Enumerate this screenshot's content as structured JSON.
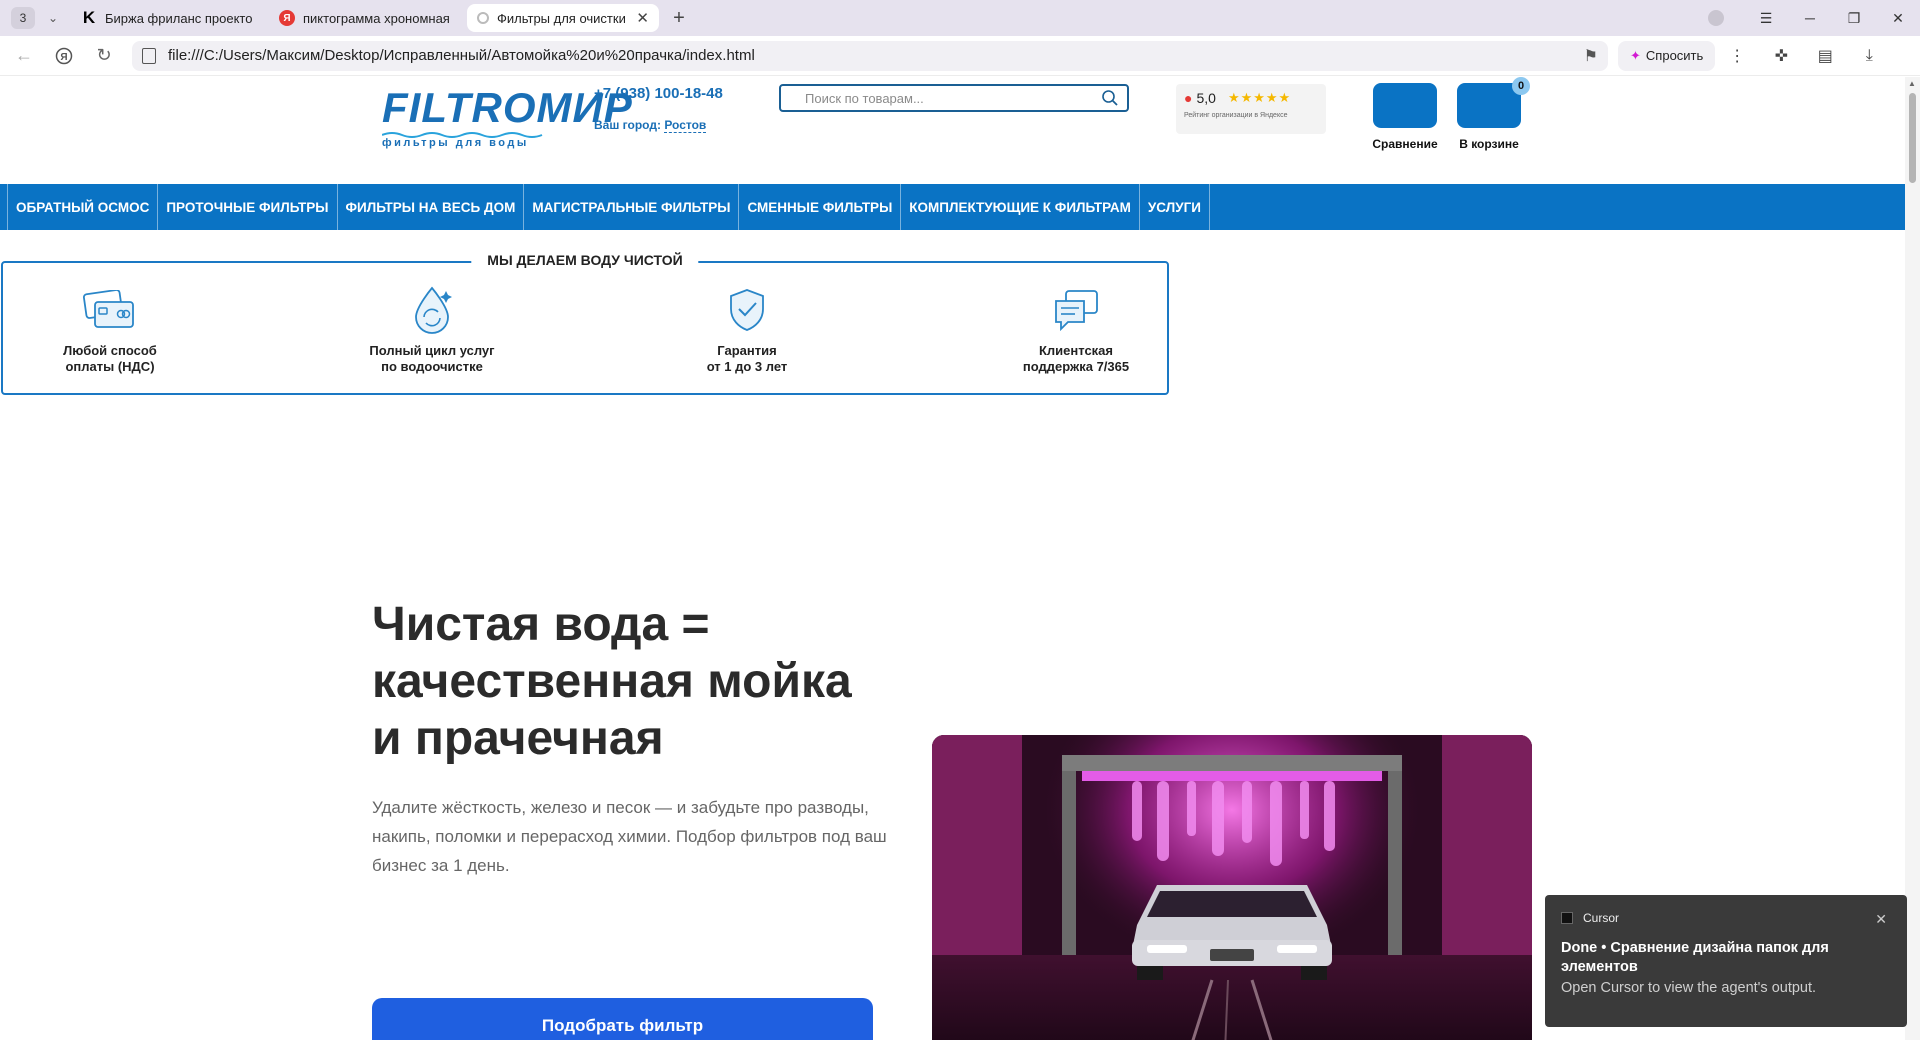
{
  "browser": {
    "tab_count": "3",
    "tabs": [
      {
        "title": "Биржа фриланс проектов",
        "favicon": "kwork-icon"
      },
      {
        "title": "пиктограмма хрономная",
        "favicon": "yandex-icon"
      },
      {
        "title": "Фильтры для очистки в",
        "favicon": "file-icon",
        "active": true
      }
    ],
    "url": "file:///C:/Users/Максим/Desktop/Исправленный/Автомойка%20и%20прачка/index.html",
    "ask_label": "Спросить"
  },
  "header": {
    "logo_word": "FILTROМИР",
    "logo_tagline": "фильтры для воды",
    "phone": "+7 (938) 100-18-48",
    "city_label": "Ваш город:",
    "city": "Ростов",
    "search_placeholder": "Поиск по товарам...",
    "rating_score": "5,0",
    "rating_stars": "★★★★★",
    "rating_caption": "Рейтинг организации в Яндексе",
    "compare_label": "Сравнение",
    "cart_label": "В корзине",
    "cart_count": "0"
  },
  "catnav": [
    "ОБРАТНЫЙ ОСМОС",
    "ПРОТОЧНЫЕ ФИЛЬТРЫ",
    "ФИЛЬТРЫ НА ВЕСЬ ДОМ",
    "МАГИСТРАЛЬНЫЕ ФИЛЬТРЫ",
    "СМЕННЫЕ ФИЛЬТРЫ",
    "КОМПЛЕКТУЮЩИЕ К ФИЛЬТРАМ",
    "УСЛУГИ"
  ],
  "features": {
    "legend": "МЫ ДЕЛАЕМ ВОДУ ЧИСТОЙ",
    "items": [
      {
        "line1": "Любой способ",
        "line2": "оплаты (НДС)",
        "icon": "cards-icon"
      },
      {
        "line1": "Полный цикл услуг",
        "line2": "по водоочистке",
        "icon": "water-drop-icon"
      },
      {
        "line1": "Гарантия",
        "line2": "от 1 до 3 лет",
        "icon": "shield-check-icon"
      },
      {
        "line1": "Клиентская",
        "line2": "поддержка 7/365",
        "icon": "chat-icon"
      }
    ]
  },
  "hero": {
    "title": "Чистая вода = качественная мойка и прачечная",
    "subtitle": "Удалите жёсткость, железо и песок — и забудьте про разводы, накипь, поломки и перерасход химии. Подбор фильтров под ваш бизнес за 1 день.",
    "cta": "Подобрать фильтр"
  },
  "toast": {
    "app": "Cursor",
    "heading": "Done • Сравнение дизайна папок для элементов",
    "body": "Open Cursor to view the agent's output."
  },
  "colors": {
    "brand_blue": "#0a73c4",
    "cta_blue": "#1f5fe0",
    "car_wash_pink": "#e23ad0"
  }
}
